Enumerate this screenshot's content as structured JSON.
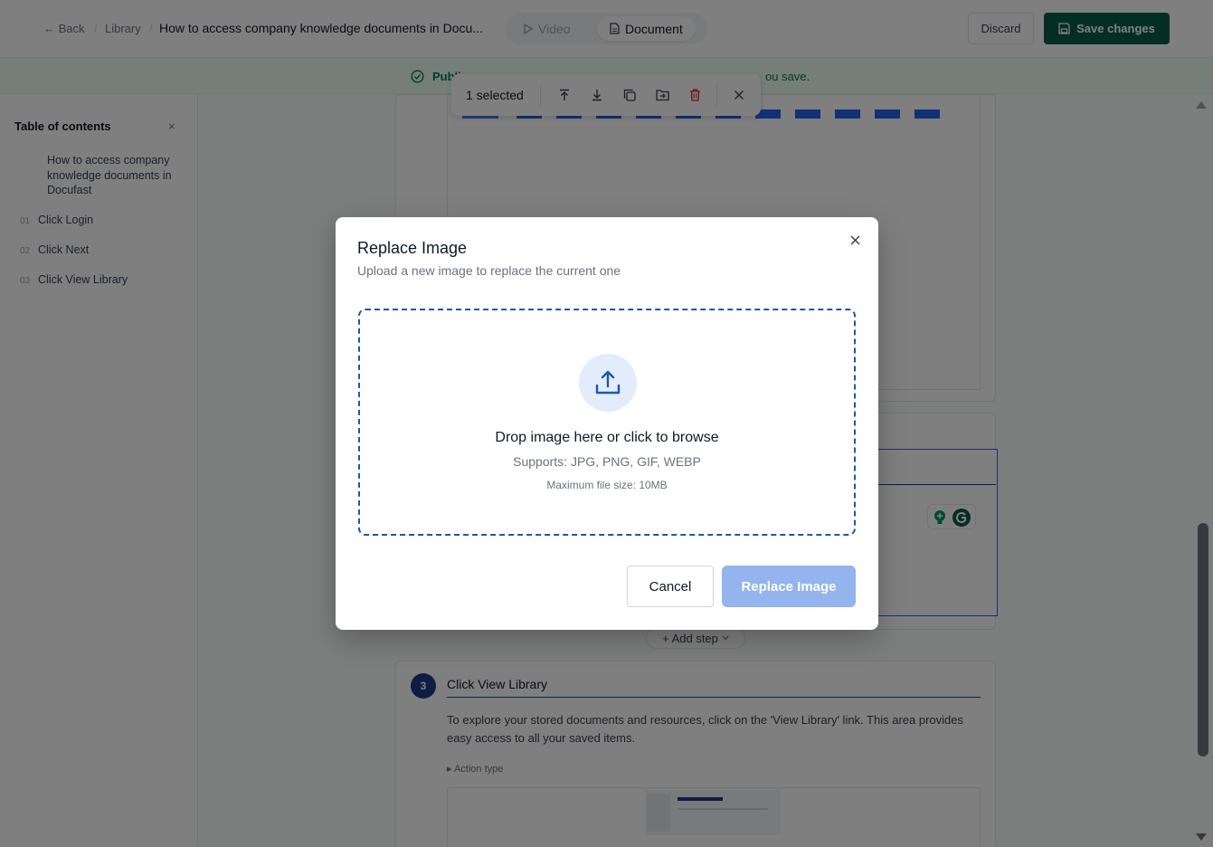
{
  "header": {
    "back_label": "Back",
    "breadcrumb_library": "Library",
    "doc_title": "How to access company knowledge documents in Docu...",
    "tab_video": "Video",
    "tab_document": "Document",
    "discard_label": "Discard",
    "save_label": "Save changes"
  },
  "banner": {
    "text": "Publi",
    "tail": "ou save."
  },
  "selection_toolbar": {
    "label": "1 selected"
  },
  "sidebar": {
    "heading": "Table of contents",
    "close": "×",
    "intro": "How to access company knowledge documents in Docufast",
    "items": [
      {
        "num": "01",
        "label": "Click Login"
      },
      {
        "num": "02",
        "label": "Click Next"
      },
      {
        "num": "03",
        "label": "Click View Library"
      }
    ]
  },
  "step3": {
    "number": "3",
    "title": "Click View Library",
    "description": "To explore your stored documents and resources, click on the 'View Library' link. This area provides easy access to all your saved items.",
    "action_type": "▸ Action type"
  },
  "add_step_label": "+ Add step",
  "modal": {
    "title": "Replace Image",
    "subtitle": "Upload a new image to replace the current one",
    "drop_text": "Drop image here or click to browse",
    "supports": "Supports: JPG, PNG, GIF, WEBP",
    "max_size": "Maximum file size: 10MB",
    "cancel_label": "Cancel",
    "replace_label": "Replace Image"
  },
  "colors": {
    "save_button": "#065f46",
    "banner_bg": "#ecfdf5",
    "dropzone_border": "#1e56b0",
    "replace_button": "#93b4ec",
    "step_accent": "#1e3a8a",
    "delete_icon": "#dc2626"
  }
}
